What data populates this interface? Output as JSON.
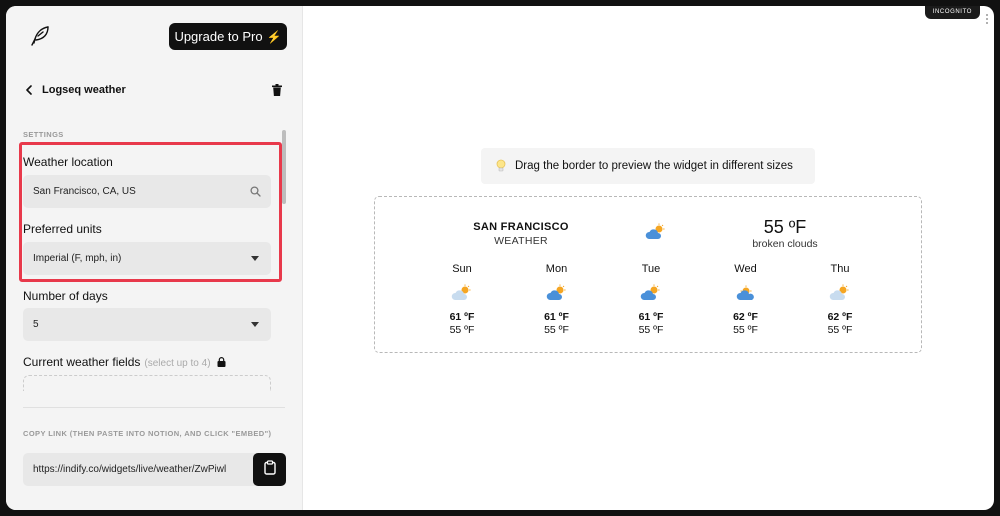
{
  "browser": {
    "badge": "INCOGNITO"
  },
  "sidebar": {
    "upgrade_label": "Upgrade to Pro",
    "upgrade_symbol": "⚡",
    "widget_title": "Logseq weather",
    "settings_label": "SETTINGS",
    "location": {
      "label": "Weather location",
      "value": "San Francisco, CA, US"
    },
    "units": {
      "label": "Preferred units",
      "value": "Imperial (F, mph, in)"
    },
    "days": {
      "label": "Number of days",
      "value": "5"
    },
    "fields": {
      "label": "Current weather fields",
      "hint": "(select up to 4)"
    },
    "copy": {
      "label": "COPY LINK (THEN PASTE INTO NOTION, AND CLICK \"EMBED\")",
      "url": "https://indify.co/widgets/live/weather/ZwPiwl"
    }
  },
  "preview": {
    "tip": "Drag the border to preview the widget in different sizes",
    "widget": {
      "city": "SAN FRANCISCO",
      "city_sub": "WEATHER",
      "current_temp": "55 ºF",
      "current_desc": "broken clouds",
      "current_icon": "sun-cloud-icon",
      "forecast": [
        {
          "day": "Sun",
          "icon": "sun-cloud-light-icon",
          "hi": "61 ºF",
          "lo": "55 ºF"
        },
        {
          "day": "Mon",
          "icon": "sun-cloud-icon",
          "hi": "61 ºF",
          "lo": "55 ºF"
        },
        {
          "day": "Tue",
          "icon": "sun-cloud-icon",
          "hi": "61 ºF",
          "lo": "55 ºF"
        },
        {
          "day": "Wed",
          "icon": "cloud-sun-behind-icon",
          "hi": "62 ºF",
          "lo": "55 ºF"
        },
        {
          "day": "Thu",
          "icon": "sun-cloud-light-icon",
          "hi": "62 ºF",
          "lo": "55 ºF"
        }
      ]
    }
  },
  "colors": {
    "highlight": "#e8394b",
    "accent_sun": "#f5a623",
    "cloud": "#4a90d9"
  }
}
